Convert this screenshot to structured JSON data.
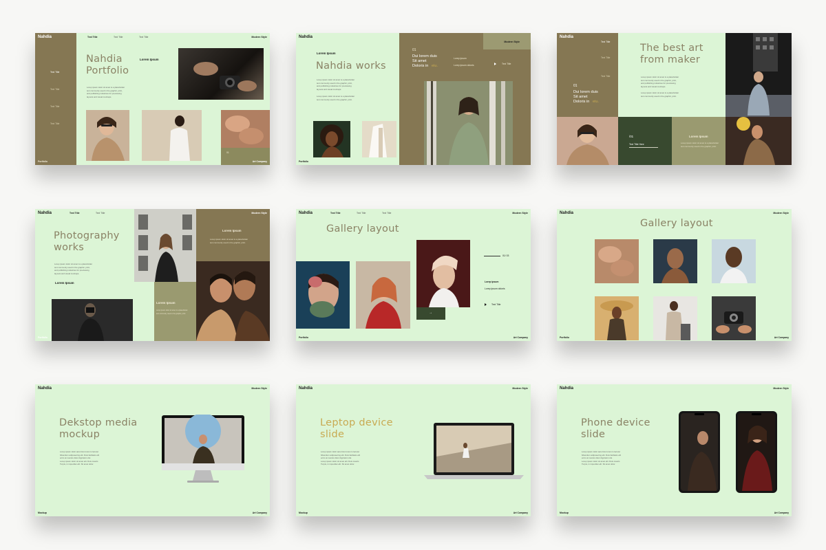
{
  "brand": {
    "name": "Nahdia",
    "modern_style": "Modern Style",
    "company": "Art Company",
    "portfolio": "Portfolio",
    "mockup": "Mockup"
  },
  "colors": {
    "background": "#dcf5d6",
    "olive": "#857753",
    "dark_green": "#38492f",
    "sage": "#9a9a70",
    "title": "#8a8265",
    "gold": "#c8aa52"
  },
  "nav": {
    "active": "Text Title",
    "item": "Text Title"
  },
  "lorem_para": "Lorep ipsum dolor sit amet is a placeholder\ntext commonly used in the graphic, print,\nand publishing industries for previewing\nlayouts and visual mockups.",
  "lorem_para_short": "Lorep ipsum dolor sit amet is a placeholder\ntext commonly used in the graphic, print.",
  "lorem_para_mock": "Lorep ipsum dolor auto bios lorem is lacurer\nbibendum adiposecing elit. Duis faciliasis elit\nenim at mensis dolor dignissim dui.\nLorep ipsum dolor sit amet elit. Duis mauris\nTurpis, in imperdiet elit. Sit amet dolor.",
  "slides": [
    {
      "title": "Nahdia\nPortfolio",
      "heading": "Lorem Ipsum",
      "side_items": [
        "Text Title",
        "Text Title",
        "Text Title",
        "Text Title"
      ],
      "badge": "01"
    },
    {
      "title": "Nahdia works",
      "heading": "Lorem Ipsum",
      "number": "01",
      "big_text": "Dui lorem duis\nSit amet\nDoloris in",
      "big_text_tail": "eiu.",
      "caption": "Lorep ipsum",
      "caption2": "Lorep ipsum doloris",
      "link": "Text Title"
    },
    {
      "title": "The best art\nfrom maker",
      "number": "01",
      "big_text": "Dui lorem duis\nSit amet\nDoloris in",
      "big_text_tail": "eiu.",
      "side_items": [
        "Text Title",
        "Text Title",
        "Text Title"
      ],
      "box_num": "/01",
      "box_title": "Text Title Here",
      "box_heading": "Lorem Ipsum"
    },
    {
      "title": "Photography\nworks",
      "heading": "Lorem Ipsum",
      "heading_box1": "Lorem Ipsum",
      "heading_box2": "Lorem Ipsum"
    },
    {
      "title": "Gallery layout",
      "page": "01/ 03",
      "caption": "Lorep ipsum",
      "caption2": "Lorep ipsum doloris",
      "link": "Text Title",
      "arrow": "→"
    },
    {
      "title": "Gallery layout"
    },
    {
      "title": "Dekstop media\nmockup"
    },
    {
      "title": "Leptop device\nslide"
    },
    {
      "title": "Phone device\nslide"
    }
  ]
}
